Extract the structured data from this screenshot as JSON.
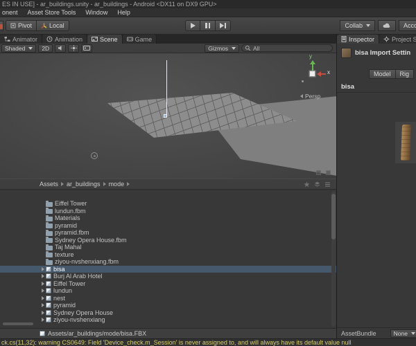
{
  "window": {
    "title": "ES IN USE] - ar_buildings.unity - ar_buildings - Android <DX11 on DX9 GPU>"
  },
  "menu_bar": {
    "items": [
      "onent",
      "Asset Store Tools",
      "Window",
      "Help"
    ]
  },
  "toolbar": {
    "pivot_label": "Pivot",
    "local_label": "Local",
    "collab_label": "Collab",
    "account_label": "Acco"
  },
  "view_tabs": [
    {
      "label": "Animator",
      "active": false
    },
    {
      "label": "Animation",
      "active": false
    },
    {
      "label": "Scene",
      "active": true
    },
    {
      "label": "Game",
      "active": false
    }
  ],
  "scene_toolbar": {
    "shaded_label": "Shaded",
    "mode_2d_label": "2D",
    "gizmos_label": "Gizmos",
    "search_value": "All"
  },
  "scene_view": {
    "axis_y_label": "y",
    "axis_x_label": "x",
    "projection_label": "Persp"
  },
  "project_panel": {
    "breadcrumbs": [
      {
        "label": "Assets"
      },
      {
        "label": "ar_buildings"
      },
      {
        "label": "mode"
      }
    ],
    "items": [
      {
        "label": "Eiffel Tower",
        "type": "folder",
        "selected": false
      },
      {
        "label": "lundun.fbm",
        "type": "folder",
        "selected": false
      },
      {
        "label": "Materials",
        "type": "folder",
        "selected": false
      },
      {
        "label": "pyramid",
        "type": "folder",
        "selected": false
      },
      {
        "label": "pyramid.fbm",
        "type": "folder",
        "selected": false
      },
      {
        "label": "Sydney Opera House.fbm",
        "type": "folder",
        "selected": false
      },
      {
        "label": "Taj Mahal",
        "type": "folder",
        "selected": false
      },
      {
        "label": "texture",
        "type": "folder",
        "selected": false
      },
      {
        "label": "ziyou-nvshenxiang.fbm",
        "type": "folder",
        "selected": false
      },
      {
        "label": "bisa",
        "type": "model",
        "selected": true
      },
      {
        "label": "Burj Al Arab Hotel",
        "type": "model",
        "selected": false
      },
      {
        "label": "Eiffel Tower",
        "type": "model",
        "selected": false
      },
      {
        "label": "lundun",
        "type": "model",
        "selected": false
      },
      {
        "label": "nest",
        "type": "model",
        "selected": false
      },
      {
        "label": "pyramid",
        "type": "model",
        "selected": false
      },
      {
        "label": "Sydney Opera House",
        "type": "model",
        "selected": false
      },
      {
        "label": "ziyou-nvshenxiang",
        "type": "model",
        "selected": false
      }
    ],
    "selected_asset_path": "Assets/ar_buildings/mode/bisa.FBX"
  },
  "inspector": {
    "tabs": [
      {
        "label": "Inspector",
        "active": true
      },
      {
        "label": "Project S",
        "active": false
      }
    ],
    "header_title": "bisa Import Settin",
    "mode_tabs": [
      {
        "label": "Model"
      },
      {
        "label": "Rig"
      }
    ],
    "object_name": "bisa",
    "assetbundle": {
      "label": "AssetBundle",
      "value": "None"
    }
  },
  "status_bar": {
    "message": "ck.cs(11,32): warning CS0649: Field 'Device_check.m_Session' is never assigned to, and will always have its default value null"
  }
}
